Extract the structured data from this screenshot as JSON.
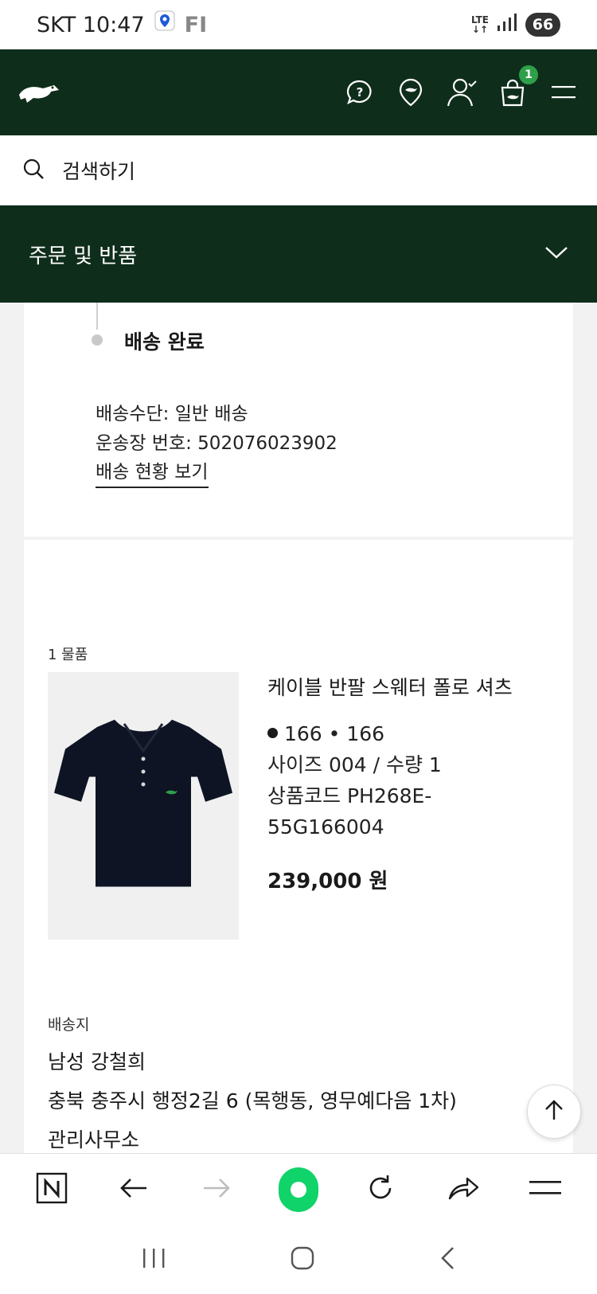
{
  "status_bar": {
    "carrier_time": "SKT 10:47",
    "app_text": "FI",
    "network": "LTE",
    "battery": "66"
  },
  "header": {
    "cart_count": "1",
    "icons": [
      "lacoste-crocodile-logo",
      "help-icon",
      "store-locator-icon",
      "account-icon",
      "cart-icon",
      "menu-icon"
    ]
  },
  "search": {
    "placeholder": "검색하기"
  },
  "section": {
    "title": "주문 및 반품"
  },
  "delivery": {
    "status": "배송 완료",
    "method": "배송수단: 일반 배송",
    "tracking_number": "운송장 번호: 502076023902",
    "tracking_link": "배송 현황 보기"
  },
  "item": {
    "count": "1 물품",
    "name": "케이블 반팔 스웨터 폴로 셔츠",
    "color": "166 • 166",
    "size_qty": "사이즈 004 / 수량 1",
    "code_line1": "상품코드 PH268E-",
    "code_line2": "55G166004",
    "price": "239,000 원"
  },
  "shipping": {
    "label": "배송지",
    "name": "남성 강철희",
    "address": "충북 충주시 행정2길 6 (목행동, 영무예다음 1차)",
    "address2": "관리사무소"
  },
  "colors": {
    "brand_green": "#0f2d1b",
    "badge_green": "#2ea04a",
    "browser_home": "#10d36a"
  }
}
